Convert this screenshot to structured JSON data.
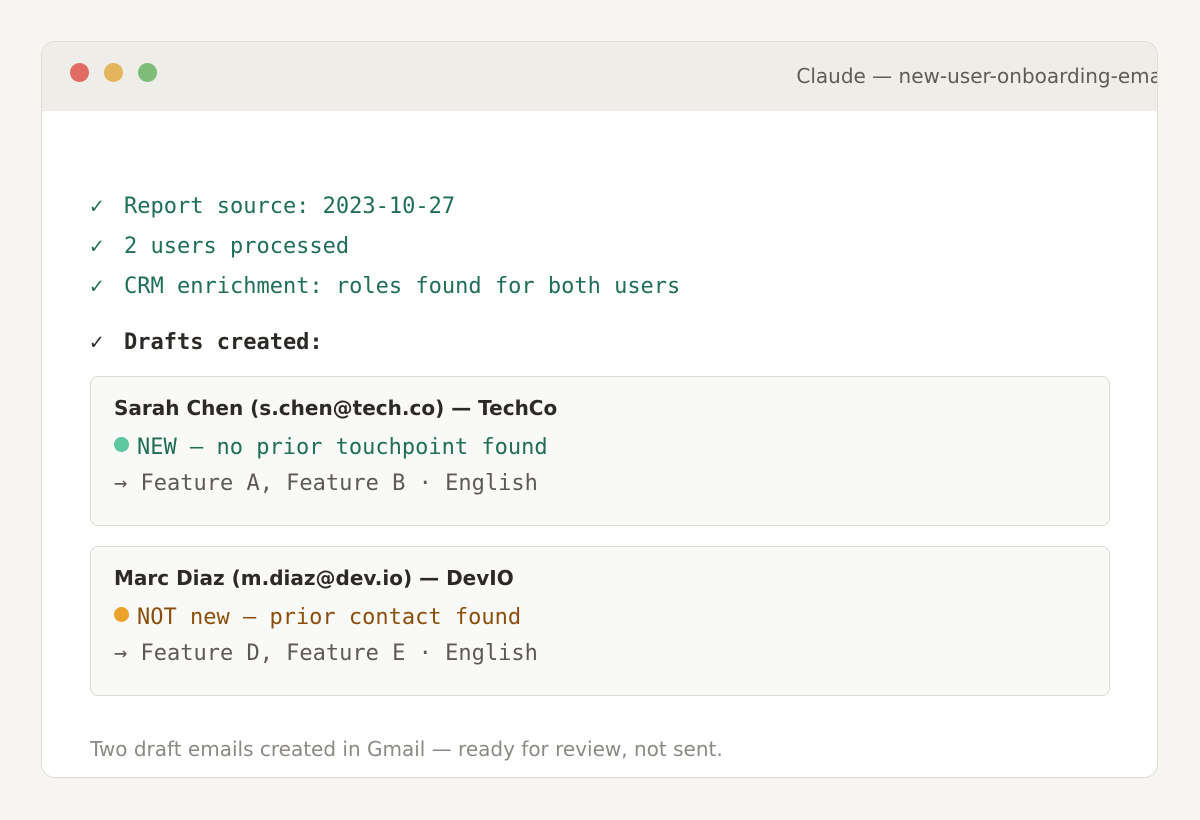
{
  "window": {
    "title": "Claude — new-user-onboarding-email"
  },
  "status_lines": [
    {
      "check": "✓",
      "text": "Report source: 2023-10-27"
    },
    {
      "check": "✓",
      "text": "2 users processed"
    },
    {
      "check": "✓",
      "text": "CRM enrichment: roles found for both users"
    }
  ],
  "drafts": {
    "check": "✓",
    "label": "Drafts created:"
  },
  "cards": [
    {
      "name": "Sarah Chen (s.chen@tech.co) — TechCo",
      "status": "NEW — no prior touchpoint found",
      "status_color": "#1f6e55",
      "dot_color": "#5ec6a0",
      "features": "→ Feature A, Feature B · English"
    },
    {
      "name": "Marc Diaz (m.diaz@dev.io) — DevIO",
      "status": "NOT new — prior contact found",
      "status_color": "#8a4f0c",
      "dot_color": "#eba32c",
      "features": "→ Feature D, Feature E · English"
    }
  ],
  "footer": "Two draft emails created in Gmail — ready for review, not sent."
}
